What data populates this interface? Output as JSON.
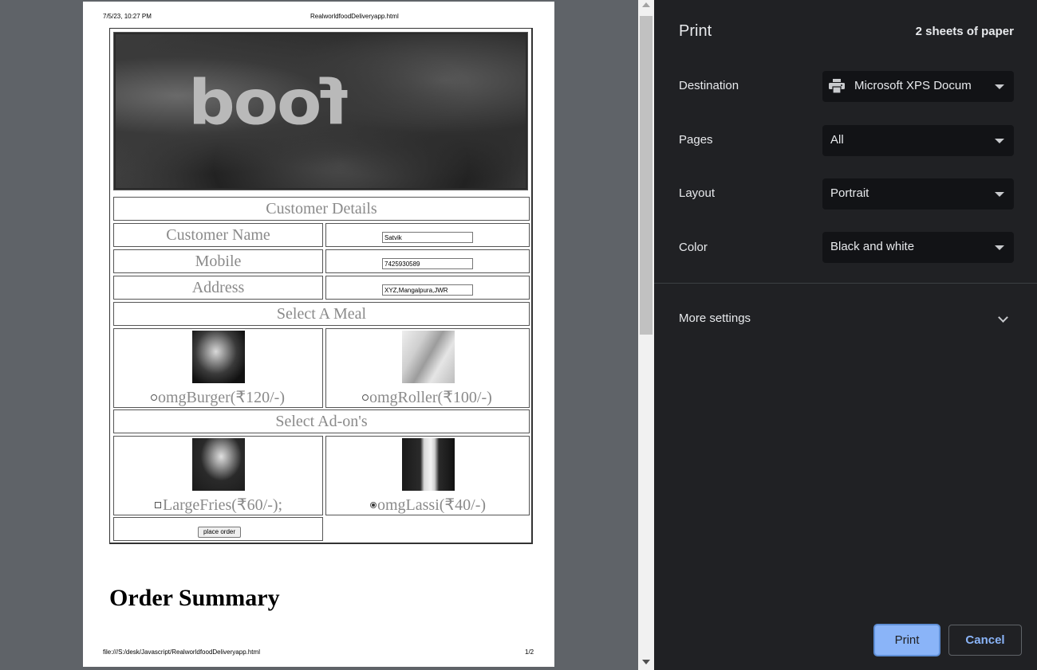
{
  "preview": {
    "header_date": "7/5/23, 10:27 PM",
    "header_file": "RealworldfoodDeliveryapp.html",
    "footer_url": "file:///S:/desk/Javascript/RealworldfoodDeliveryapp.html",
    "footer_page": "1/2",
    "banner_word": "food",
    "customer_details_heading": "Customer Details",
    "fields": [
      {
        "label": "Customer Name",
        "value": "Satvik"
      },
      {
        "label": "Mobile",
        "value": "7425930589"
      },
      {
        "label": "Address",
        "value": "XYZ,Mangalpura,JWR"
      }
    ],
    "meal_heading": "Select A Meal",
    "meals": [
      {
        "label": "omgBurger(₹120/-)",
        "checked": false
      },
      {
        "label": "omgRoller(₹100/-)",
        "checked": false
      }
    ],
    "addon_heading": "Select Ad-on's",
    "addons": [
      {
        "label": "LargeFries(₹60/-);",
        "checked": false
      },
      {
        "label": "omgLassi(₹40/-)",
        "checked": true
      }
    ],
    "place_order_label": "place order",
    "order_summary_title": "Order Summary"
  },
  "panel": {
    "title": "Print",
    "sheets": "2 sheets of paper",
    "destination_label": "Destination",
    "destination_value": "Microsoft XPS Docum",
    "destination_icon": "printer-icon",
    "pages_label": "Pages",
    "pages_value": "All",
    "layout_label": "Layout",
    "layout_value": "Portrait",
    "color_label": "Color",
    "color_value": "Black and white",
    "more_settings_label": "More settings",
    "print_label": "Print",
    "cancel_label": "Cancel",
    "accent_color": "#8ab4f8"
  }
}
